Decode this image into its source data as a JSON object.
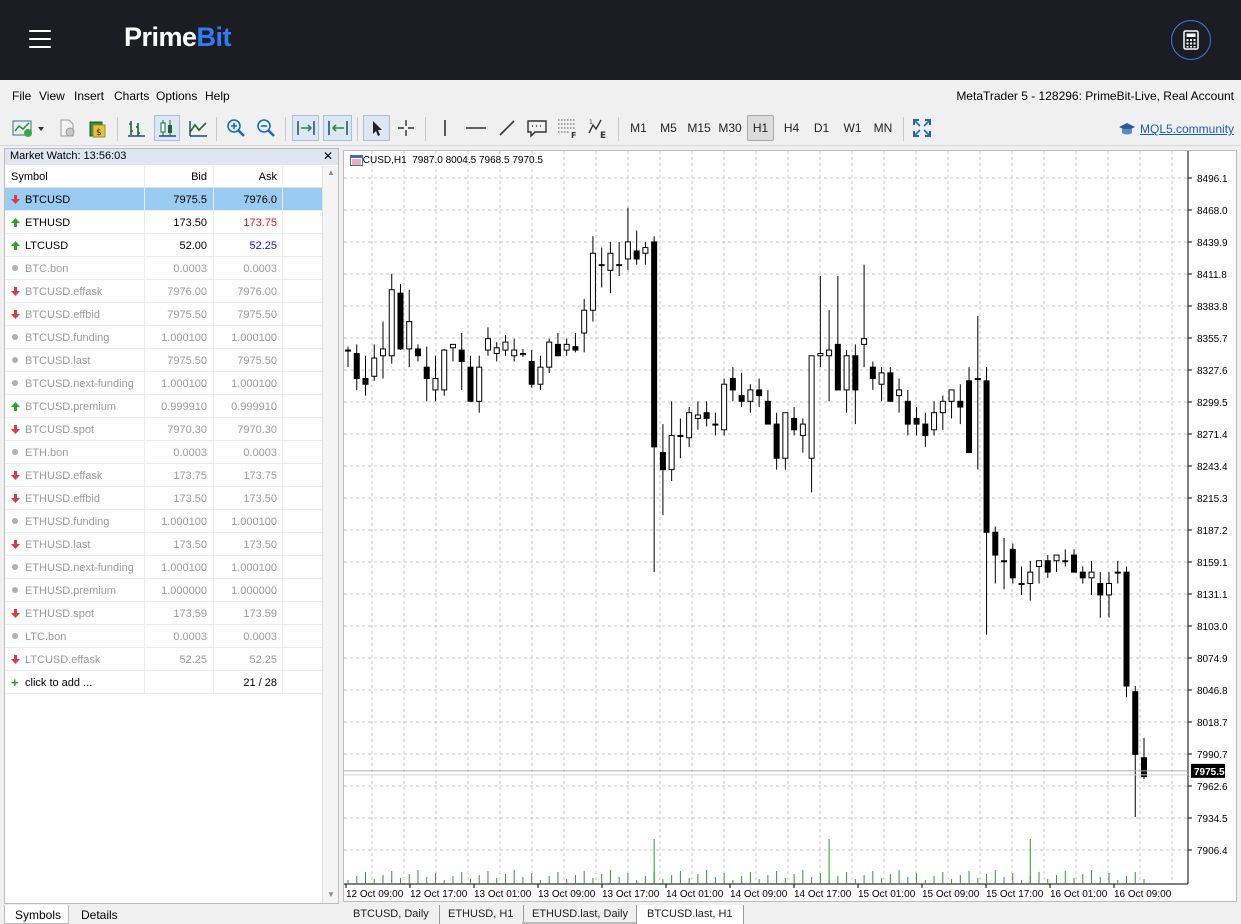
{
  "header": {
    "logo_part1": "Prime",
    "logo_part2": "Bit",
    "menu_icon": "hamburger-icon",
    "calc_icon": "calculator-icon"
  },
  "menu": {
    "items": [
      "File",
      "View",
      "Insert",
      "Charts",
      "Options",
      "Help"
    ],
    "account_info": "MetaTrader 5 - 128296: PrimeBit-Live, Real Account"
  },
  "toolbar": {
    "timeframes": [
      "M1",
      "M5",
      "M15",
      "M30",
      "H1",
      "H4",
      "D1",
      "W1",
      "MN"
    ],
    "active_timeframe": "H1",
    "community_link": "MQL5.community"
  },
  "market_watch": {
    "title": "Market Watch: 13:56:03",
    "columns": [
      "Symbol",
      "Bid",
      "Ask"
    ],
    "rows": [
      {
        "symbol": "BTCUSD",
        "bid": "7975.5",
        "ask": "7976.0",
        "dir": "down",
        "style": "selected"
      },
      {
        "symbol": "ETHUSD",
        "bid": "173.50",
        "ask": "173.75",
        "dir": "up",
        "style": "red"
      },
      {
        "symbol": "LTCUSD",
        "bid": "52.00",
        "ask": "52.25",
        "dir": "up",
        "style": "blue"
      },
      {
        "symbol": "BTC.bon",
        "bid": "0.0003",
        "ask": "0.0003",
        "dir": "none",
        "style": "grey"
      },
      {
        "symbol": "BTCUSD.effask",
        "bid": "7976.00",
        "ask": "7976.00",
        "dir": "down",
        "style": "grey"
      },
      {
        "symbol": "BTCUSD.effbid",
        "bid": "7975.50",
        "ask": "7975.50",
        "dir": "down",
        "style": "grey"
      },
      {
        "symbol": "BTCUSD.funding",
        "bid": "1.000100",
        "ask": "1.000100",
        "dir": "none",
        "style": "grey"
      },
      {
        "symbol": "BTCUSD.last",
        "bid": "7975.50",
        "ask": "7975.50",
        "dir": "none",
        "style": "grey"
      },
      {
        "symbol": "BTCUSD.next-funding",
        "bid": "1.000100",
        "ask": "1.000100",
        "dir": "none",
        "style": "grey"
      },
      {
        "symbol": "BTCUSD.premium",
        "bid": "0.999910",
        "ask": "0.999910",
        "dir": "up",
        "style": "grey"
      },
      {
        "symbol": "BTCUSD.spot",
        "bid": "7970.30",
        "ask": "7970.30",
        "dir": "down",
        "style": "grey"
      },
      {
        "symbol": "ETH.bon",
        "bid": "0.0003",
        "ask": "0.0003",
        "dir": "none",
        "style": "grey"
      },
      {
        "symbol": "ETHUSD.effask",
        "bid": "173.75",
        "ask": "173.75",
        "dir": "down",
        "style": "grey"
      },
      {
        "symbol": "ETHUSD.effbid",
        "bid": "173.50",
        "ask": "173.50",
        "dir": "down",
        "style": "grey"
      },
      {
        "symbol": "ETHUSD.funding",
        "bid": "1.000100",
        "ask": "1.000100",
        "dir": "none",
        "style": "grey"
      },
      {
        "symbol": "ETHUSD.last",
        "bid": "173.50",
        "ask": "173.50",
        "dir": "down",
        "style": "grey"
      },
      {
        "symbol": "ETHUSD.next-funding",
        "bid": "1.000100",
        "ask": "1.000100",
        "dir": "none",
        "style": "grey"
      },
      {
        "symbol": "ETHUSD.premium",
        "bid": "1.000000",
        "ask": "1.000000",
        "dir": "none",
        "style": "grey"
      },
      {
        "symbol": "ETHUSD.spot",
        "bid": "173.59",
        "ask": "173.59",
        "dir": "down",
        "style": "grey"
      },
      {
        "symbol": "LTC.bon",
        "bid": "0.0003",
        "ask": "0.0003",
        "dir": "none",
        "style": "grey"
      },
      {
        "symbol": "LTCUSD.effask",
        "bid": "52.25",
        "ask": "52.25",
        "dir": "down",
        "style": "grey"
      }
    ],
    "add_row": {
      "label": "click to add ...",
      "count": "21 / 28"
    },
    "tabs": [
      "Symbols",
      "Details"
    ]
  },
  "chart": {
    "ohlc_label": "BTCUSD,H1  7987.0 8004.5 7968.5 7970.5",
    "current_price": "7975.5",
    "price_ticks": [
      "8496.1",
      "8468.0",
      "8439.9",
      "8411.8",
      "8383.8",
      "8355.7",
      "8327.6",
      "8299.5",
      "8271.4",
      "8243.4",
      "8215.3",
      "8187.2",
      "8159.1",
      "8131.1",
      "8103.0",
      "8074.9",
      "8046.8",
      "8018.7",
      "7990.7",
      "7962.6",
      "7934.5",
      "7906.4"
    ],
    "time_ticks": [
      "12 Oct 09:00",
      "12 Oct 17:00",
      "13 Oct 01:00",
      "13 Oct 09:00",
      "13 Oct 17:00",
      "14 Oct 01:00",
      "14 Oct 09:00",
      "14 Oct 17:00",
      "15 Oct 01:00",
      "15 Oct 09:00",
      "15 Oct 17:00",
      "16 Oct 01:00",
      "16 Oct 09:00"
    ],
    "tabs": [
      "BTCUSD, Daily",
      "ETHUSD, H1",
      "ETHUSD.last, Daily",
      "BTCUSD.last, H1"
    ]
  },
  "chart_data": {
    "type": "candlestick",
    "symbol": "BTCUSD",
    "timeframe": "H1",
    "ylim": [
      7880,
      8510
    ],
    "last_bar": {
      "open": 7987.0,
      "high": 8004.5,
      "low": 7968.5,
      "close": 7970.5
    },
    "ohlc": [
      [
        8345,
        8348,
        8330,
        8345
      ],
      [
        8342,
        8350,
        8310,
        8320
      ],
      [
        8320,
        8340,
        8305,
        8315
      ],
      [
        8322,
        8350,
        8318,
        8338
      ],
      [
        8340,
        8370,
        8320,
        8346
      ],
      [
        8340,
        8412,
        8333,
        8398
      ],
      [
        8395,
        8403,
        8345,
        8346
      ],
      [
        8346,
        8398,
        8330,
        8370
      ],
      [
        8346,
        8350,
        8335,
        8340
      ],
      [
        8330,
        8348,
        8300,
        8320
      ],
      [
        8310,
        8340,
        8300,
        8320
      ],
      [
        8310,
        8346,
        8305,
        8345
      ],
      [
        8347,
        8350,
        8335,
        8350
      ],
      [
        8345,
        8360,
        8310,
        8335
      ],
      [
        8330,
        8340,
        8300,
        8300
      ],
      [
        8300,
        8340,
        8290,
        8330
      ],
      [
        8345,
        8365,
        8340,
        8355
      ],
      [
        8342,
        8352,
        8335,
        8347
      ],
      [
        8345,
        8358,
        8340,
        8352
      ],
      [
        8340,
        8355,
        8335,
        8345
      ],
      [
        8341,
        8346,
        8339,
        8342
      ],
      [
        8335,
        8345,
        8312,
        8315
      ],
      [
        8315,
        8340,
        8310,
        8330
      ],
      [
        8330,
        8355,
        8325,
        8352
      ],
      [
        8350,
        8360,
        8340,
        8340
      ],
      [
        8345,
        8355,
        8340,
        8350
      ],
      [
        8348,
        8360,
        8343,
        8345
      ],
      [
        8360,
        8390,
        8343,
        8380
      ],
      [
        8380,
        8445,
        8370,
        8430
      ],
      [
        8420,
        8435,
        8400,
        8420
      ],
      [
        8415,
        8440,
        8395,
        8430
      ],
      [
        8420,
        8440,
        8410,
        8420
      ],
      [
        8425,
        8470,
        8415,
        8440
      ],
      [
        8432,
        8450,
        8420,
        8425
      ],
      [
        8430,
        8440,
        8420,
        8435
      ],
      [
        8440,
        8445,
        8150,
        8260
      ],
      [
        8255,
        8280,
        8200,
        8240
      ],
      [
        8240,
        8300,
        8230,
        8270
      ],
      [
        8270,
        8285,
        8250,
        8270
      ],
      [
        8268,
        8295,
        8260,
        8290
      ],
      [
        8285,
        8300,
        8275,
        8288
      ],
      [
        8290,
        8300,
        8278,
        8285
      ],
      [
        8280,
        8290,
        8270,
        8280
      ],
      [
        8275,
        8320,
        8270,
        8315
      ],
      [
        8320,
        8330,
        8300,
        8310
      ],
      [
        8305,
        8325,
        8295,
        8300
      ],
      [
        8300,
        8315,
        8290,
        8310
      ],
      [
        8310,
        8320,
        8295,
        8305
      ],
      [
        8300,
        8310,
        8280,
        8280
      ],
      [
        8280,
        8290,
        8240,
        8250
      ],
      [
        8250,
        8290,
        8240,
        8290
      ],
      [
        8285,
        8295,
        8270,
        8275
      ],
      [
        8270,
        8285,
        8255,
        8280
      ],
      [
        8250,
        8330,
        8220,
        8340
      ],
      [
        8340,
        8410,
        8330,
        8342
      ],
      [
        8340,
        8380,
        8300,
        8345
      ],
      [
        8350,
        8410,
        8320,
        8310
      ],
      [
        8310,
        8345,
        8290,
        8340
      ],
      [
        8340,
        8350,
        8280,
        8310
      ],
      [
        8350,
        8420,
        8330,
        8355
      ],
      [
        8330,
        8335,
        8310,
        8320
      ],
      [
        8315,
        8330,
        8300,
        8325
      ],
      [
        8325,
        8330,
        8300,
        8300
      ],
      [
        8305,
        8320,
        8290,
        8310
      ],
      [
        8300,
        8310,
        8270,
        8280
      ],
      [
        8285,
        8295,
        8270,
        8280
      ],
      [
        8280,
        8290,
        8260,
        8270
      ],
      [
        8275,
        8300,
        8270,
        8290
      ],
      [
        8290,
        8305,
        8275,
        8300
      ],
      [
        8300,
        8310,
        8285,
        8310
      ],
      [
        8300,
        8315,
        8280,
        8295
      ],
      [
        8318,
        8330,
        8255,
        8255
      ],
      [
        8320,
        8375,
        8240,
        8320
      ],
      [
        8318,
        8330,
        8095,
        8185
      ],
      [
        8185,
        8190,
        8140,
        8165
      ],
      [
        8160,
        8180,
        8135,
        8160
      ],
      [
        8170,
        8175,
        8140,
        8145
      ],
      [
        8140,
        8155,
        8130,
        8140
      ],
      [
        8140,
        8160,
        8125,
        8150
      ],
      [
        8155,
        8160,
        8140,
        8160
      ],
      [
        8160,
        8165,
        8145,
        8150
      ],
      [
        8160,
        8165,
        8150,
        8165
      ],
      [
        8160,
        8170,
        8155,
        8160
      ],
      [
        8165,
        8170,
        8150,
        8150
      ],
      [
        8150,
        8155,
        8140,
        8145
      ],
      [
        8145,
        8160,
        8130,
        8150
      ],
      [
        8140,
        8150,
        8110,
        8130
      ],
      [
        8130,
        8150,
        8110,
        8140
      ],
      [
        8150,
        8160,
        8140,
        8150
      ],
      [
        8150,
        8155,
        8040,
        8050
      ],
      [
        8045,
        8050,
        7935,
        7990
      ],
      [
        7987,
        8004.5,
        7968.5,
        7970.5
      ]
    ],
    "volume_spikes": {
      "13 Oct 17:00": "high",
      "14 Oct 17:00": "high",
      "15 Oct 09:00": "high",
      "16 Oct 09:00": "high"
    }
  }
}
